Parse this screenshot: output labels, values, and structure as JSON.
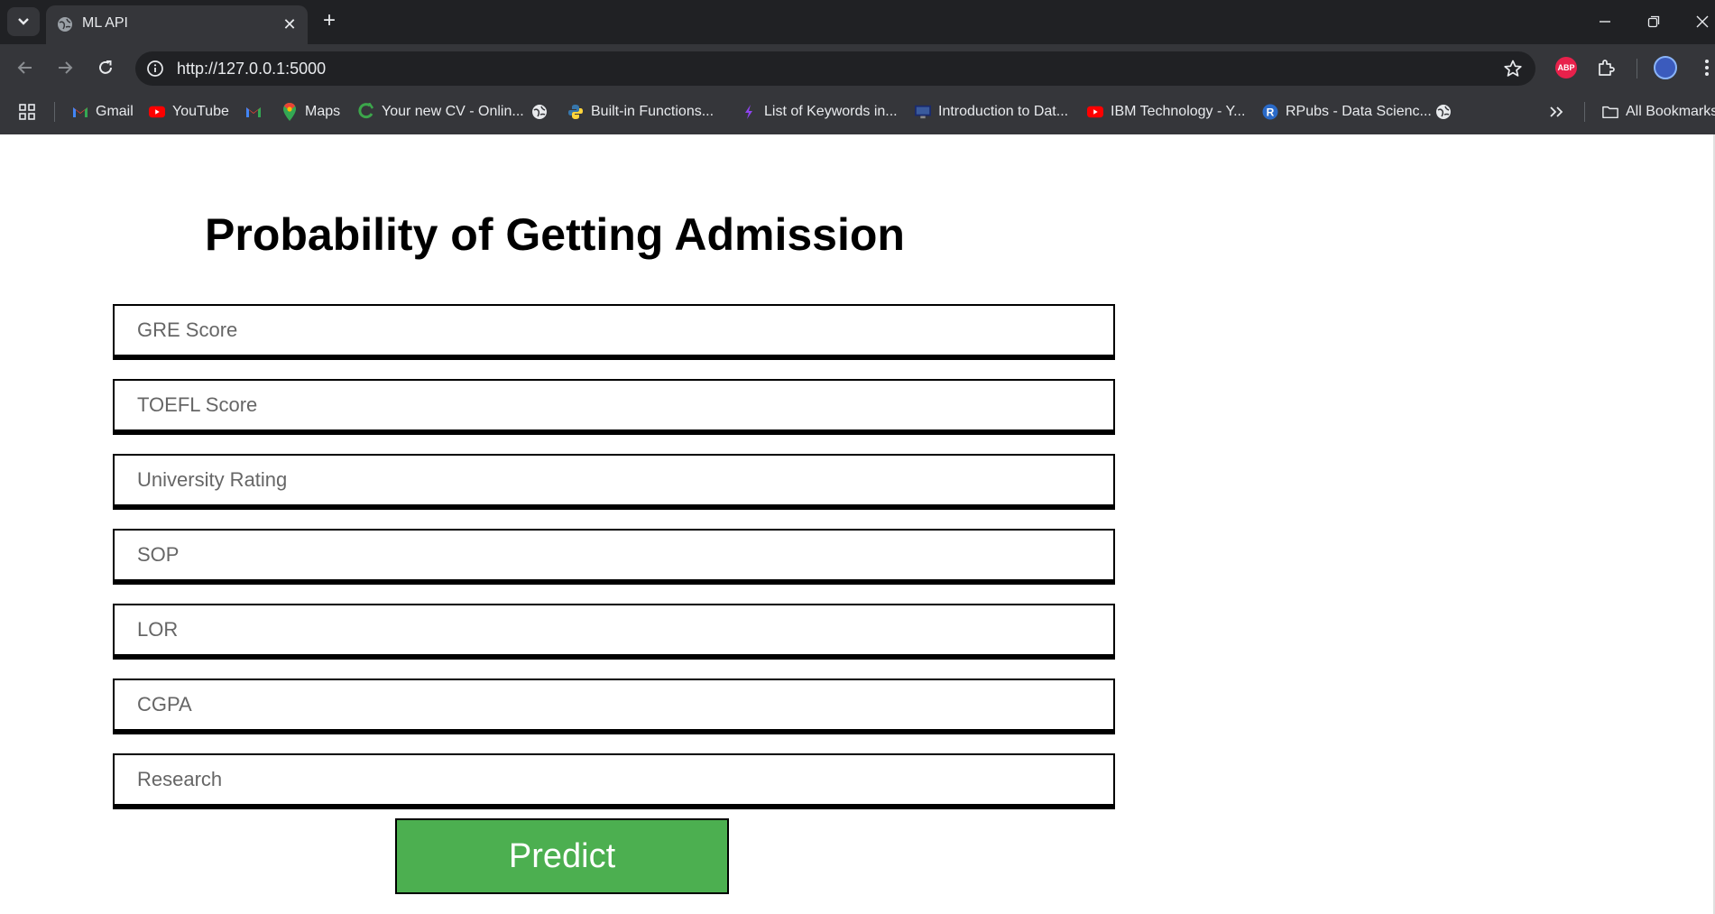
{
  "browser": {
    "tab": {
      "title": "ML API"
    },
    "address": {
      "url": "http://127.0.0.1:5000"
    },
    "extensions": {
      "adblock_label": "ABP"
    },
    "bookmarks": [
      {
        "label": "Gmail",
        "icon": "gmail-icon"
      },
      {
        "label": "YouTube",
        "icon": "youtube-icon"
      },
      {
        "label": "",
        "icon": "gmail-icon"
      },
      {
        "label": "Maps",
        "icon": "maps-icon"
      },
      {
        "label": "Your new CV - Onlin...",
        "icon": "cv-icon"
      },
      {
        "label": "",
        "icon": "globe-icon"
      },
      {
        "label": "Built-in Functions...",
        "icon": "python-icon"
      },
      {
        "label": "List of Keywords in...",
        "icon": "keyword-icon"
      },
      {
        "label": "Introduction to Dat...",
        "icon": "monitor-icon"
      },
      {
        "label": "IBM Technology - Y...",
        "icon": "youtube-icon"
      },
      {
        "label": "RPubs - Data Scienc...",
        "icon": "rpubs-icon"
      },
      {
        "label": "",
        "icon": "globe-icon"
      }
    ],
    "all_bookmarks_label": "All Bookmarks"
  },
  "page": {
    "title": "Probability of Getting Admission",
    "fields": [
      {
        "placeholder": "GRE Score",
        "value": ""
      },
      {
        "placeholder": "TOEFL Score",
        "value": ""
      },
      {
        "placeholder": "University Rating",
        "value": ""
      },
      {
        "placeholder": "SOP",
        "value": ""
      },
      {
        "placeholder": "LOR",
        "value": ""
      },
      {
        "placeholder": "CGPA",
        "value": ""
      },
      {
        "placeholder": "Research",
        "value": ""
      }
    ],
    "predict_label": "Predict",
    "colors": {
      "predict_button": "#4caf50",
      "chrome_dark": "#202124",
      "chrome_mid": "#35363a"
    }
  }
}
